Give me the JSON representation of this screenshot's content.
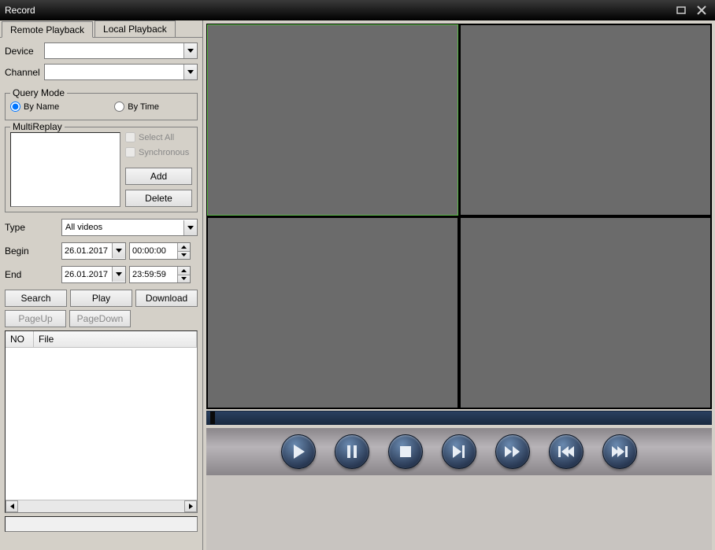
{
  "title": "Record",
  "tabs": {
    "remote": "Remote Playback",
    "local": "Local Playback"
  },
  "form": {
    "device_label": "Device",
    "device_value": "",
    "channel_label": "Channel",
    "channel_value": ""
  },
  "queryMode": {
    "legend": "Query Mode",
    "byName": "By Name",
    "byTime": "By Time",
    "selected": "byName"
  },
  "multiReplay": {
    "legend": "MultiReplay",
    "selectAll": "Select All",
    "synchronous": "Synchronous",
    "add": "Add",
    "delete": "Delete"
  },
  "filter": {
    "type_label": "Type",
    "type_value": "All videos",
    "begin_label": "Begin",
    "begin_date": "26.01.2017",
    "begin_time": "00:00:00",
    "end_label": "End",
    "end_date": "26.01.2017",
    "end_time": "23:59:59"
  },
  "actions": {
    "search": "Search",
    "play": "Play",
    "download": "Download",
    "pageUp": "PageUp",
    "pageDown": "PageDown"
  },
  "fileList": {
    "colNo": "NO",
    "colFile": "File"
  },
  "player": {
    "play": "play",
    "pause": "pause",
    "stop": "stop",
    "step": "step",
    "fwd": "fast-forward",
    "prev": "previous",
    "next": "next"
  }
}
